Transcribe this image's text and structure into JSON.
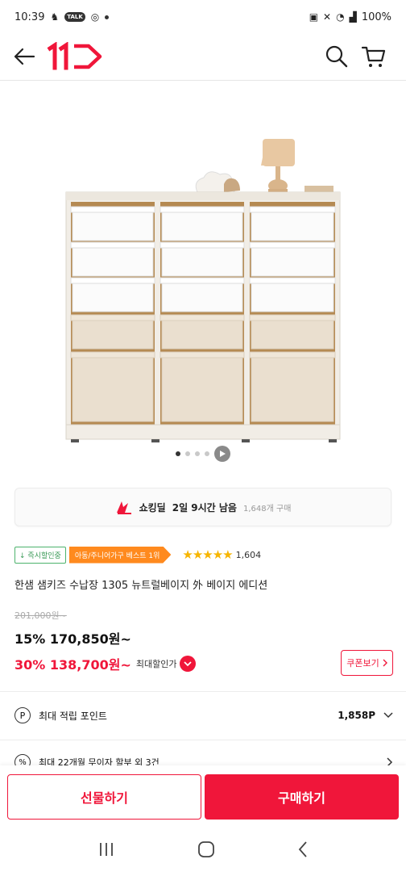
{
  "status_bar": {
    "time": "10:39",
    "talk_badge": "TALK",
    "battery": "100%"
  },
  "header": {
    "logo_text": "11",
    "back_icon": "arrow-left-icon",
    "search_icon": "search-icon",
    "cart_icon": "cart-icon",
    "brand_color": "#f0163a"
  },
  "product": {
    "carousel": {
      "total": 4,
      "active": 1
    },
    "deal": {
      "name": "쇼킹딜",
      "time_left": "2일 9시간 남음",
      "purchases": "1,648개 구매"
    },
    "badges": {
      "instant_discount": "즉시할인중",
      "best": "아동/주니어가구 베스트 1위"
    },
    "rating": {
      "stars": 5,
      "stars_text": "★★★★★",
      "count": "1,604"
    },
    "title": "한샘 샘키즈 수납장 1305 뉴트럴베이지 外 베이지 에디션",
    "original_price": "201,000원~",
    "price_15": "15% 170,850원~",
    "price_30": "30% 138,700원~",
    "max_discount_label": "최대할인가",
    "coupon_label": "쿠폰보기"
  },
  "points": {
    "label": "최대 적립 포인트",
    "value": "1,858P"
  },
  "installment": {
    "label": "최대 22개월 무이자 할부 외 3건"
  },
  "actions": {
    "gift": "선물하기",
    "buy": "구매하기"
  }
}
